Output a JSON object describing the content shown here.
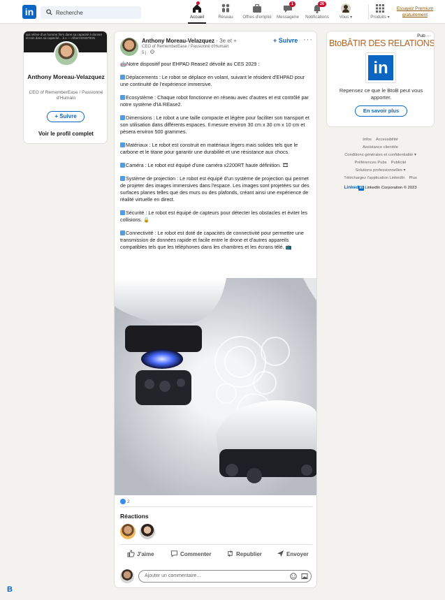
{
  "header": {
    "search_placeholder": "Recherche",
    "nav": [
      {
        "label": "Accueil",
        "badge": ""
      },
      {
        "label": "Réseau",
        "badge": ""
      },
      {
        "label": "Offres d'emploi",
        "badge": ""
      },
      {
        "label": "Messagerie",
        "badge": "1"
      },
      {
        "label": "Notifications",
        "badge": "26"
      },
      {
        "label": "Vous ▾",
        "badge": ""
      },
      {
        "label": "Produits ▾",
        "badge": ""
      }
    ],
    "premium": "Essayez Premium gratuitement"
  },
  "profile": {
    "banner_text": "qui relève d'un homme fiers dans sa capacité à donner et non dans sa capacité... à x  — Albert EINSTEIN",
    "name": "Anthony Moreau-Velazquez",
    "headline": "CEO of RememberEase / Passionné d'Humain",
    "follow": "+ Suivre",
    "see_full": "Voir le profil complet"
  },
  "post": {
    "author": "Anthony Moreau-Velazquez",
    "degree": " · 3e et +",
    "headline": "CEO of RememberEase / Passionné d'Humain",
    "time": "5 j · ",
    "follow": "+ Suivre",
    "more": "···",
    "intro": "🤖Notre dispositif pour EHPAD Rease2 dévoilé au CES 2029 :",
    "paragraphs": [
      "Déplacements : Le robot se déplace en volant, suivant le résident d'EHPAD pour une continuité de l'expérience immersive.",
      "Ecosystème : Chaque robot fonctionne en réseau avec d'autres et est contrôlé par notre système d'IA REase2.",
      "Dimensions : Le robot a une taille compacte et légère pour faciliter son transport et son utilisation dans différents espaces. Il mesure environ 30 cm x 30 cm x 10 cm et pèsera environ 500 grammes.",
      "Matériaux : Le robot est construit en matériaux légers mais solides tels que le carbone et le titane pour garantir une durabilité et une résistance aux chocs.",
      "Caméra : Le robot est équipé d'une caméra x2200RT haute définition. 🎞",
      "Système de projection : Le robot est équipé d'un système de projection qui permet de projeter des images immersives dans l'espace. Les images sont projetées sur des surfaces planes telles que des murs ou des plafonds, créant ainsi une expérience de réalité virtuelle en direct.",
      "Sécurité : Le robot est équipé de capteurs pour détecter les obstacles et éviter les collisions. 🔒",
      "Connectivité : Le robot est doté de capacités de connectivité pour permettre une transmission de données rapide et facile entre le drone et d'autres appareils compatibles tels que les téléphones dans les chambres et les écrans télé. 📺"
    ],
    "reaction_count": "2",
    "reactions_title": "Réactions",
    "actions": {
      "like": "J'aime",
      "comment": "Commenter",
      "repost": "Republier",
      "send": "Envoyer"
    },
    "comment_placeholder": "Ajouter un commentaire…"
  },
  "ad": {
    "pub": "Pub ···",
    "title": "BtoBÂTIR DES RELATIONS",
    "text": "Repensez ce que le BtoB peut vous apporter.",
    "cta": "En savoir plus"
  },
  "footer": {
    "row1": [
      "Infos",
      "Accessibilité"
    ],
    "row2": [
      "Assistance clientèle"
    ],
    "row3": [
      "Conditions générales et confidentialité ▾"
    ],
    "row4": [
      "Préférences Pubs",
      "Publicité"
    ],
    "row5": [
      "Solutions professionnelles ▾"
    ],
    "row6": [
      "Téléchargez l'application LinkedIn",
      "Plus"
    ],
    "brand_word": "Linked",
    "brand_in": "in",
    "copyright": " LinkedIn Corporation © 2023"
  },
  "corner_mark": "B",
  "colors": {
    "brand": "#0a66c2",
    "badge": "#cb112d",
    "ad_title": "#b5601f",
    "background": "#f4f2ee"
  }
}
